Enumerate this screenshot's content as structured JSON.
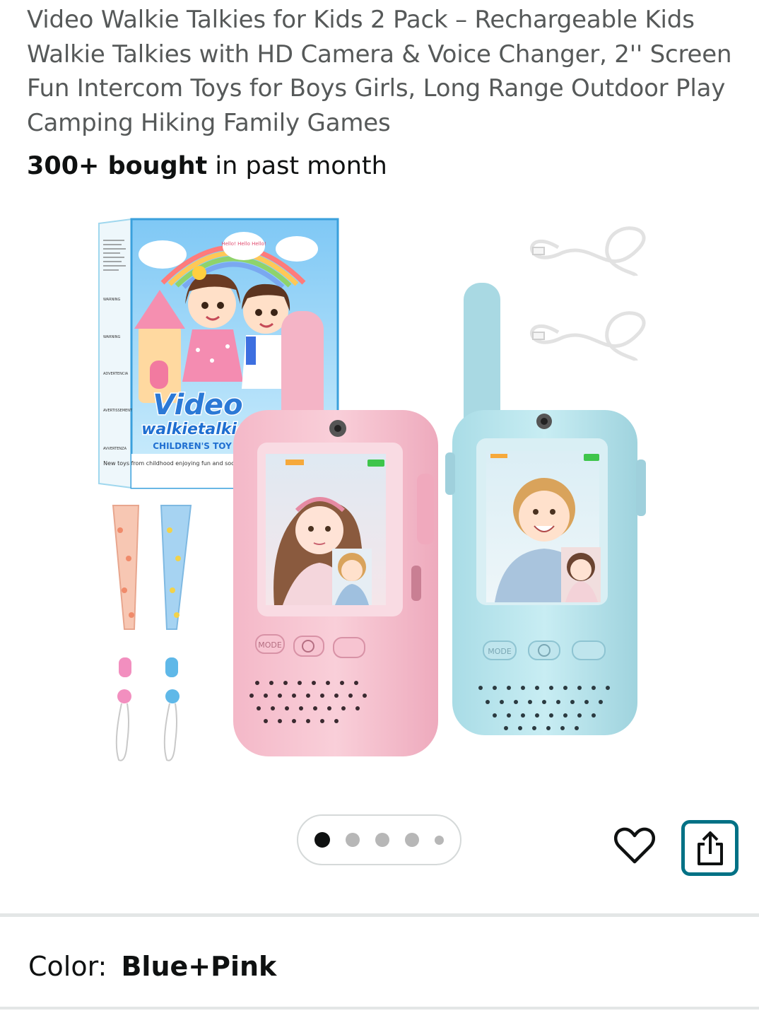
{
  "product": {
    "title": "Video Walkie Talkies for Kids 2 Pack – Rechargeable Kids Walkie Talkies with HD Camera & Voice Changer, 2'' Screen Fun Intercom Toys for Boys Girls, Long Range Outdoor Play Camping Hiking Family Games",
    "bought_count": "300+ bought",
    "bought_suffix": " in past month"
  },
  "image": {
    "box_brand_line1": "Video",
    "box_brand_line2": "walkietalkie",
    "box_brand_line3": "CHILDREN'S TOY",
    "box_tagline": "New toys from childhood enjoying fun and socializing with children",
    "box_speech": "Hello! Hello Hello!",
    "warnings": [
      "WARNING",
      "WARNING",
      "ADVERTENCIA",
      "AVERTISSEMENT",
      "AVVERTENZA"
    ],
    "button_mode": "MODE",
    "pink_device_color": "#f7c6d2",
    "blue_device_color": "#bfe6ee"
  },
  "carousel": {
    "total": 5,
    "active_index": 0
  },
  "actions": {
    "wishlist_icon": "heart-icon",
    "share_icon": "share-icon",
    "accent_color": "#007185"
  },
  "variation": {
    "label": "Color:",
    "value": "Blue+Pink"
  }
}
